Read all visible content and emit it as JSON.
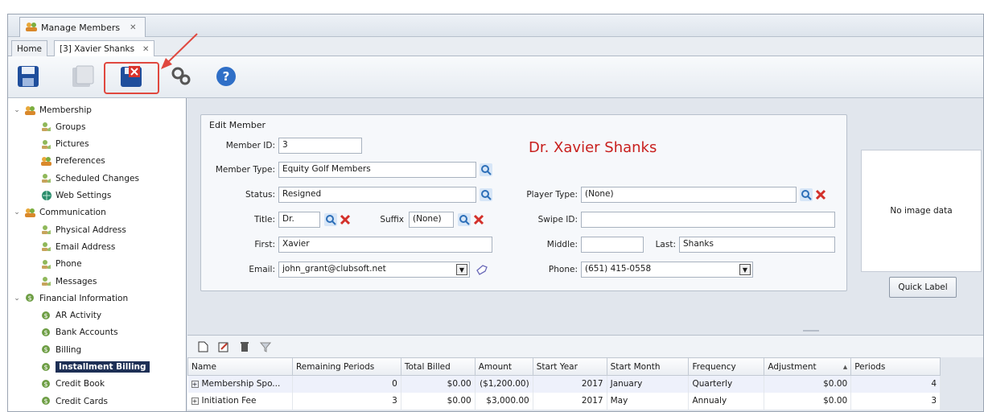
{
  "window": {
    "doc_tab": "Manage Members",
    "sub_tabs": {
      "home": "Home",
      "member": "[3] Xavier Shanks"
    }
  },
  "toolbar": {
    "buttons": [
      "save-icon",
      "save-new-icon",
      "save-close-icon",
      "gears-icon",
      "help-icon"
    ]
  },
  "tree": {
    "items": [
      {
        "label": "Membership",
        "level": 0,
        "expander": "⌄",
        "icon": "people-icon"
      },
      {
        "label": "Groups",
        "level": 1,
        "icon": "group-icon"
      },
      {
        "label": "Pictures",
        "level": 1,
        "icon": "group-icon"
      },
      {
        "label": "Preferences",
        "level": 1,
        "icon": "preferences-icon"
      },
      {
        "label": "Scheduled Changes",
        "level": 1,
        "icon": "group-icon"
      },
      {
        "label": "Web Settings",
        "level": 1,
        "icon": "globe-icon"
      },
      {
        "label": "Communication",
        "level": 0,
        "expander": "⌄",
        "icon": "people-icon"
      },
      {
        "label": "Physical Address",
        "level": 1,
        "icon": "group-icon"
      },
      {
        "label": "Email Address",
        "level": 1,
        "icon": "group-icon"
      },
      {
        "label": "Phone",
        "level": 1,
        "icon": "group-icon"
      },
      {
        "label": "Messages",
        "level": 1,
        "icon": "group-icon"
      },
      {
        "label": "Financial Information",
        "level": 0,
        "expander": "⌄",
        "icon": "money-icon"
      },
      {
        "label": "AR Activity",
        "level": 1,
        "icon": "money-icon"
      },
      {
        "label": "Bank Accounts",
        "level": 1,
        "icon": "money-icon"
      },
      {
        "label": "Billing",
        "level": 1,
        "icon": "money-icon"
      },
      {
        "label": "Installment Billing",
        "level": 1,
        "icon": "money-icon",
        "selected": true
      },
      {
        "label": "Credit Book",
        "level": 1,
        "icon": "money-icon"
      },
      {
        "label": "Credit Cards",
        "level": 1,
        "icon": "money-icon"
      }
    ]
  },
  "form": {
    "group_title": "Edit Member",
    "member_name": "Dr. Xavier Shanks",
    "labels": {
      "member_id": "Member ID:",
      "member_type": "Member Type:",
      "status": "Status:",
      "title": "Title:",
      "suffix": "Suffix",
      "first": "First:",
      "email": "Email:",
      "player_type": "Player Type:",
      "swipe_id": "Swipe ID:",
      "middle": "Middle:",
      "last": "Last:",
      "phone": "Phone:"
    },
    "values": {
      "member_id": "3",
      "member_type": "Equity Golf Members",
      "status": "Resigned",
      "title": "Dr.",
      "suffix": "(None)",
      "first": "Xavier",
      "email": "john_grant@clubsoft.net",
      "player_type": "(None)",
      "swipe_id": "",
      "middle": "",
      "last": "Shanks",
      "phone": "(651) 415-0558"
    },
    "image_text": "No image data",
    "quick_label_button": "Quick Label"
  },
  "grid": {
    "columns": [
      "Name",
      "Remaining Periods",
      "Total Billed",
      "Amount",
      "Start Year",
      "Start Month",
      "Frequency",
      "Adjustment",
      "Periods"
    ],
    "sort_indicator": "▴",
    "rows": [
      {
        "name": "Membership Spo...",
        "remaining": "0",
        "total_billed": "$0.00",
        "amount": "($1,200.00)",
        "start_year": "2017",
        "start_month": "January",
        "frequency": "Quarterly",
        "adjustment": "$0.00",
        "periods": "4"
      },
      {
        "name": "Initiation Fee",
        "remaining": "3",
        "total_billed": "$0.00",
        "amount": "$3,000.00",
        "start_year": "2017",
        "start_month": "May",
        "frequency": "Annualy",
        "adjustment": "$0.00",
        "periods": "3"
      }
    ]
  },
  "colors": {
    "highlight": "#e0483f",
    "member_name": "#c8201e",
    "selected_bg": "#1d2f55"
  }
}
